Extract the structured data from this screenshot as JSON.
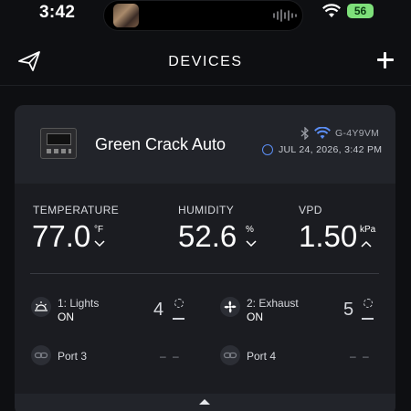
{
  "status_bar": {
    "time": "3:42",
    "battery": "56"
  },
  "header": {
    "title": "DEVICES",
    "left_icon": "paper-plane-icon",
    "right_icon": "plus-icon"
  },
  "device": {
    "name": "Green Crack Auto",
    "id": "G-4Y9VM",
    "timestamp": "JUL 24, 2026, 3:42 PM",
    "metrics": [
      {
        "label": "TEMPERATURE",
        "value": "77.0",
        "unit": "°F",
        "trend_icon": "chevron-down-icon"
      },
      {
        "label": "HUMIDITY",
        "value": "52.6",
        "unit": "%",
        "trend_icon": "chevron-down-icon"
      },
      {
        "label": "VPD",
        "value": "1.50",
        "unit": "kPa",
        "trend_icon": "chevron-up-icon"
      }
    ],
    "ports": [
      {
        "name": "1: Lights",
        "state": "ON",
        "level": "4",
        "icon": "sunrise-icon"
      },
      {
        "name": "2: Exhaust",
        "state": "ON",
        "level": "5",
        "icon": "fan-icon"
      },
      {
        "name": "Port 3",
        "state": "",
        "level": "– –",
        "icon": "link-icon"
      },
      {
        "name": "Port 4",
        "state": "",
        "level": "– –",
        "icon": "link-icon"
      }
    ]
  },
  "colors": {
    "background": "#0e0f12",
    "card": "#1b1c21",
    "accent": "#5b8ef5",
    "battery": "#7ee07a"
  }
}
